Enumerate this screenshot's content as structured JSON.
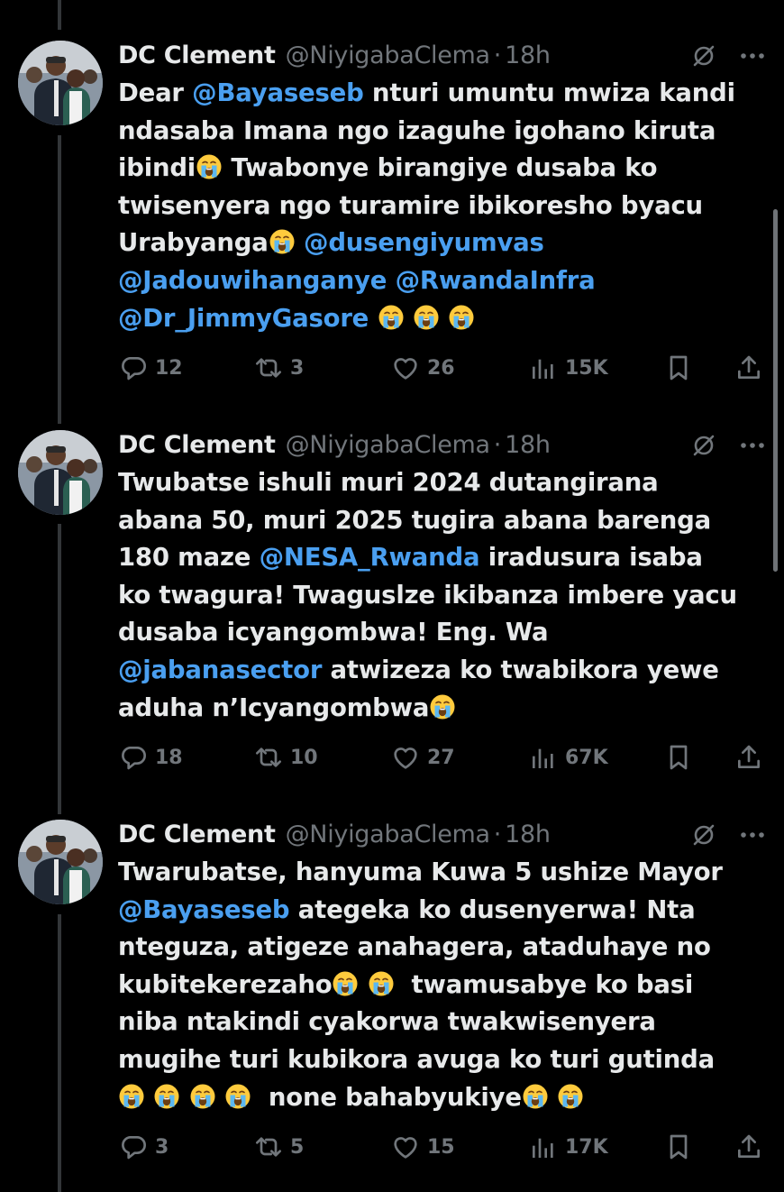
{
  "tweets": [
    {
      "author": "DC Clement",
      "handle": "@NiyigabaClema",
      "time": "18h",
      "lines": [
        [
          {
            "t": "Dear "
          },
          {
            "m": "@Bayaseseb"
          },
          {
            "t": " nturi umuntu mwiza kandi"
          }
        ],
        [
          {
            "t": "ndasaba Imana ngo izaguhe igohano kiruta"
          }
        ],
        [
          {
            "t": "ibindi"
          },
          {
            "e": "loudly-crying-face"
          },
          {
            "t": " Twabonye birangiye dusaba ko"
          }
        ],
        [
          {
            "t": "twisenyera ngo turamire ibikoresho byacu"
          }
        ],
        [
          {
            "t": "Urabyanga"
          },
          {
            "e": "loudly-crying-face"
          },
          {
            "t": " "
          },
          {
            "m": "@dusengiyumvas"
          }
        ],
        [
          {
            "m": "@Jadouwihanganye"
          },
          {
            "t": " "
          },
          {
            "m": "@RwandaInfra"
          }
        ],
        [
          {
            "m": "@Dr_JimmyGasore"
          },
          {
            "t": " "
          },
          {
            "e": "loudly-crying-face"
          },
          {
            "t": " "
          },
          {
            "e": "loudly-crying-face"
          },
          {
            "t": " "
          },
          {
            "e": "loudly-crying-face"
          }
        ]
      ],
      "replies": "12",
      "reposts": "3",
      "likes": "26",
      "views": "15K"
    },
    {
      "author": "DC Clement",
      "handle": "@NiyigabaClema",
      "time": "18h",
      "lines": [
        [
          {
            "t": "Twubatse ishuli muri 2024 dutangirana"
          }
        ],
        [
          {
            "t": "abana 50, muri 2025 tugira abana barenga"
          }
        ],
        [
          {
            "t": "180 maze "
          },
          {
            "m": "@NESA_Rwanda"
          },
          {
            "t": " iradusura isaba"
          }
        ],
        [
          {
            "t": "ko twagura! Twaguslze ikibanza imbere yacu"
          }
        ],
        [
          {
            "t": "dusaba icyangombwa! Eng. Wa"
          }
        ],
        [
          {
            "m": "@jabanasector"
          },
          {
            "t": " atwizeza ko twabikora yewe"
          }
        ],
        [
          {
            "t": "aduha n’Icyangombwa"
          },
          {
            "e": "loudly-crying-face"
          }
        ]
      ],
      "replies": "18",
      "reposts": "10",
      "likes": "27",
      "views": "67K"
    },
    {
      "author": "DC Clement",
      "handle": "@NiyigabaClema",
      "time": "18h",
      "lines": [
        [
          {
            "t": "Twarubatse, hanyuma Kuwa 5 ushize Mayor"
          }
        ],
        [
          {
            "m": "@Bayaseseb"
          },
          {
            "t": " ategeka ko dusenyerwa! Nta"
          }
        ],
        [
          {
            "t": "nteguza, atigeze anahagera, ataduhaye no"
          }
        ],
        [
          {
            "t": "kubitekerezaho"
          },
          {
            "e": "loudly-crying-face"
          },
          {
            "t": " "
          },
          {
            "e": "loudly-crying-face"
          },
          {
            "t": "  twamusabye ko basi"
          }
        ],
        [
          {
            "t": "niba ntakindi cyakorwa twakwisenyera"
          }
        ],
        [
          {
            "t": "mugihe turi kubikora avuga ko turi gutinda"
          }
        ],
        [
          {
            "e": "loudly-crying-face"
          },
          {
            "t": " "
          },
          {
            "e": "loudly-crying-face"
          },
          {
            "t": " "
          },
          {
            "e": "loudly-crying-face"
          },
          {
            "t": " "
          },
          {
            "e": "loudly-crying-face"
          },
          {
            "t": "  none bahabyukiye"
          },
          {
            "e": "loudly-crying-face"
          },
          {
            "t": " "
          },
          {
            "e": "loudly-crying-face"
          }
        ]
      ],
      "replies": "3",
      "reposts": "5",
      "likes": "15",
      "views": "17K"
    }
  ],
  "colors": {
    "background": "#000000",
    "text": "#e7e9ea",
    "muted": "#71767b",
    "mention": "#4a9ff0",
    "thread_line": "#333639"
  }
}
